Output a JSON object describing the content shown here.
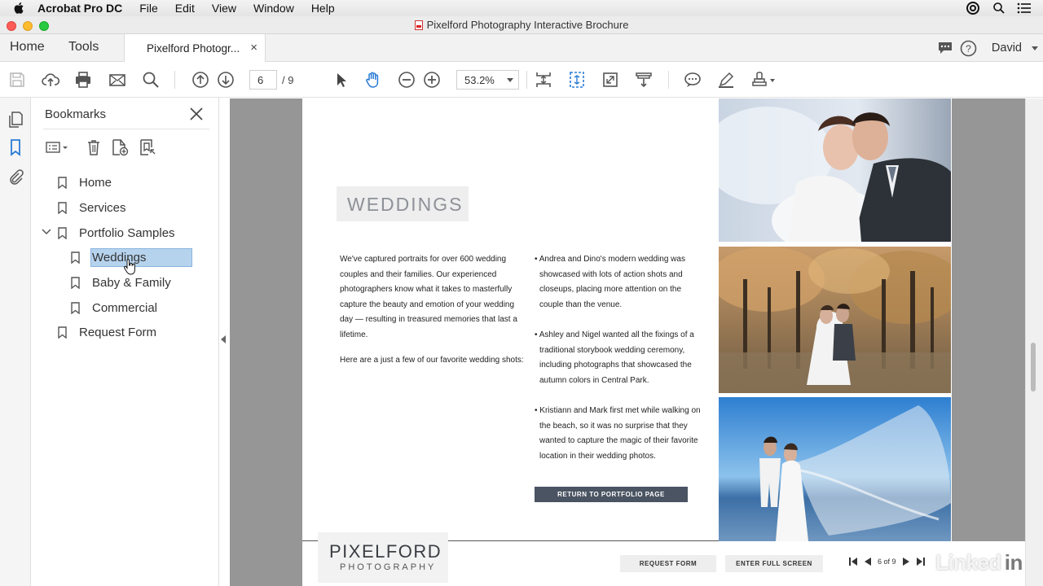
{
  "menubar": {
    "app_name": "Acrobat Pro DC",
    "items": [
      "File",
      "Edit",
      "View",
      "Window",
      "Help"
    ]
  },
  "window": {
    "title": "Pixelford Photography Interactive Brochure"
  },
  "nav": {
    "home": "Home",
    "tools": "Tools",
    "doc_tab": "Pixelford Photogr...",
    "close_tab": "×",
    "user": "David"
  },
  "toolbar": {
    "page_current": "6",
    "page_total": "/ 9",
    "zoom": "53.2%",
    "icons": [
      "save-icon",
      "upload-icon",
      "print-icon",
      "email-icon",
      "search-icon",
      "prev-page-icon",
      "next-page-icon",
      "select-arrow-icon",
      "hand-icon",
      "zoom-out-icon",
      "zoom-in-icon",
      "fit-page-icon",
      "scroll-mode-icon",
      "full-screen-icon",
      "read-mode-icon",
      "comment-icon",
      "highlight-pen-icon",
      "stamp-icon"
    ]
  },
  "bookmarks": {
    "title": "Bookmarks",
    "items": [
      {
        "label": "Home"
      },
      {
        "label": "Services"
      },
      {
        "label": "Portfolio Samples"
      },
      {
        "label": "Weddings"
      },
      {
        "label": "Baby & Family"
      },
      {
        "label": "Commercial"
      },
      {
        "label": "Request Form"
      }
    ],
    "selected": "Weddings"
  },
  "document": {
    "heading": "WEDDINGS",
    "intro": "We've captured portraits for over 600 wedding couples and their families. Our experienced photographers know what it takes to masterfully capture the beauty and emotion of your wedding day — resulting in treasured memories that last a lifetime.",
    "intro2": "Here are a just a few of our favorite wedding shots:",
    "bullets": [
      "• Andrea and Dino's modern wedding was showcased with lots of action shots and closeups, placing more attention on the couple than the venue.",
      "• Ashley and Nigel wanted all the fixings of a traditional storybook wedding ceremony, including photographs that showcased the autumn colors in Central Park.",
      "• Kristiann and Mark first met while walking on the beach, so it was no surprise that they wanted to capture the magic of their favorite location in their wedding photos."
    ],
    "return_button": "RETURN TO PORTFOLIO PAGE",
    "logo_line1": "PIXELFORD",
    "logo_line2": "PHOTOGRAPHY",
    "footer_request": "REQUEST FORM",
    "footer_fullscreen": "ENTER FULL SCREEN",
    "footer_page": "6 of 9"
  },
  "watermark": {
    "text": "Linked",
    "badge": "in"
  },
  "colors": {
    "selection": "#b6d3ee",
    "accent_blue": "#2a7bd6",
    "button_dark": "#4a5462",
    "doc_background": "#969696"
  }
}
